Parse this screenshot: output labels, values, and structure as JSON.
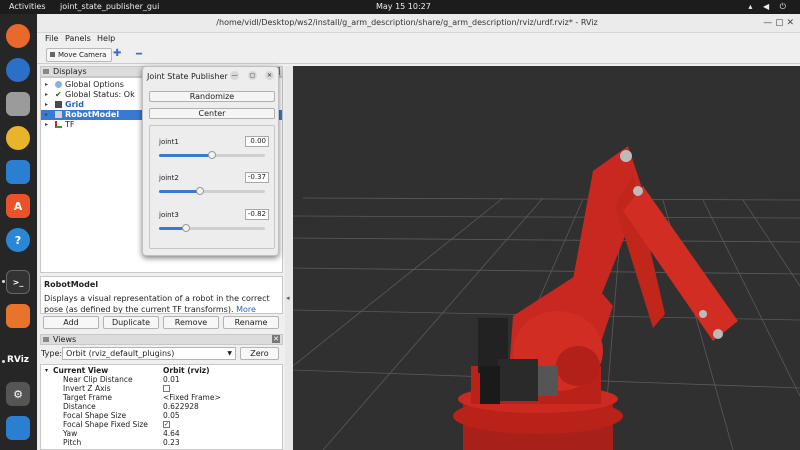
{
  "topbar": {
    "activities": "Activities",
    "app_name": "joint_state_publisher_gui",
    "clock": "May 15  10:27"
  },
  "dock": {
    "items": [
      "firefox-icon",
      "thunderbird-icon",
      "files-icon",
      "rhythmbox-icon",
      "writer-icon",
      "software-icon",
      "help-icon",
      "terminal-icon",
      "layers-icon",
      "rviz-icon",
      "settings-icon",
      "vscode-icon"
    ],
    "rviz_label": "RViz"
  },
  "window": {
    "title": "/home/vidl/Desktop/ws2/install/g_arm_description/share/g_arm_description/rviz/urdf.rviz* - RViz"
  },
  "menu": {
    "file": "File",
    "panels": "Panels",
    "help": "Help"
  },
  "toolbar": {
    "move_camera": "Move Camera"
  },
  "displays": {
    "header": "Displays",
    "items": [
      {
        "label": "Global Options",
        "color": "#1e1e1e"
      },
      {
        "label": "Global Status: Ok",
        "color": "#1e1e1e"
      },
      {
        "label": "Grid",
        "color": "#2a63c2"
      },
      {
        "label": "RobotModel",
        "color": "#ffffff"
      },
      {
        "label": "TF",
        "color": "#1e1e1e"
      }
    ],
    "description_title": "RobotModel",
    "description_text": "Displays a visual representation of a robot in the correct pose (as defined by the current TF transforms).",
    "more_info": "More Information.",
    "buttons": {
      "add": "Add",
      "duplicate": "Duplicate",
      "remove": "Remove",
      "rename": "Rename"
    }
  },
  "views": {
    "header": "Views",
    "type_label": "Type:",
    "type_value": "Orbit (rviz_default_plugins)",
    "zero": "Zero",
    "properties": [
      {
        "key": "Current View",
        "value": "Orbit (rviz)"
      },
      {
        "key": "Near Clip Distance",
        "value": "0.01"
      },
      {
        "key": "Invert Z Axis",
        "value": ""
      },
      {
        "key": "Target Frame",
        "value": "<Fixed Frame>"
      },
      {
        "key": "Distance",
        "value": "0.622928"
      },
      {
        "key": "Focal Shape Size",
        "value": "0.05"
      },
      {
        "key": "Focal Shape Fixed Size",
        "value": "✓"
      },
      {
        "key": "Yaw",
        "value": "4.64"
      },
      {
        "key": "Pitch",
        "value": "0.23"
      }
    ]
  },
  "jsp": {
    "title": "Joint State Publisher",
    "randomize": "Randomize",
    "center": "Center",
    "joints": [
      {
        "name": "joint1",
        "value": "0.00",
        "fraction": 0.5
      },
      {
        "name": "joint2",
        "value": "-0.37",
        "fraction": 0.39
      },
      {
        "name": "joint3",
        "value": "-0.82",
        "fraction": 0.25
      }
    ]
  },
  "colors": {
    "accent": "#3a79d1",
    "robot": "#c8281f",
    "viewport": "#303030"
  }
}
